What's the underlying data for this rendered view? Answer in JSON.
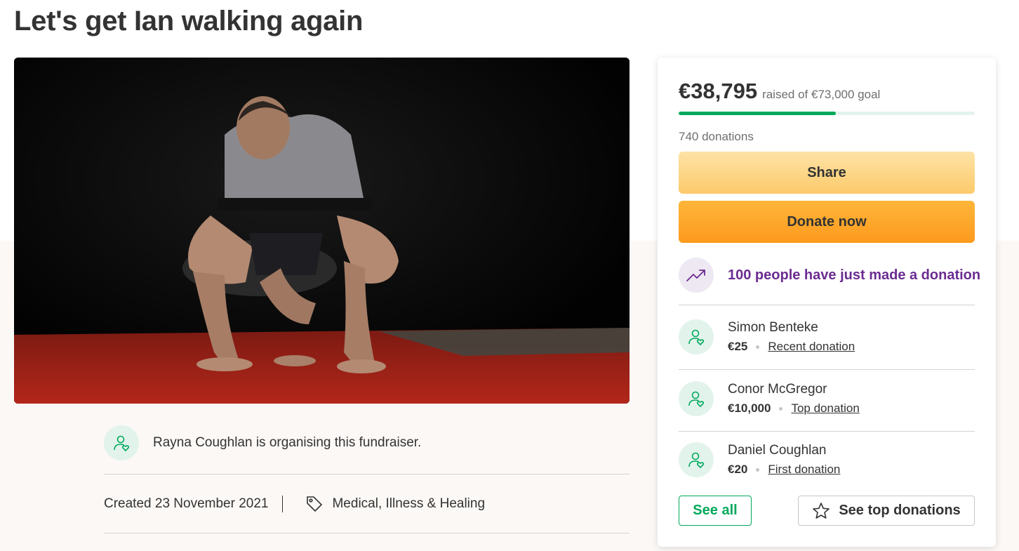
{
  "page": {
    "title": "Let's get Ian walking again"
  },
  "organiser": {
    "text": "Rayna Coughlan is organising this fundraiser.",
    "icon": "user-heart-icon"
  },
  "meta": {
    "created": "Created 23 November 2021",
    "category": "Medical, Illness & Healing",
    "category_icon": "tag-icon"
  },
  "donation_card": {
    "raised_amount": "€38,795",
    "goal_text": "raised of €73,000 goal",
    "progress_fraction": 0.531,
    "donation_count": "740 donations",
    "share_label": "Share",
    "donate_label": "Donate now",
    "trend_text": "100 people have just made a donation",
    "trend_icon": "trending-up-icon",
    "donors": [
      {
        "name": "Simon Benteke",
        "amount": "€25",
        "type": "Recent donation"
      },
      {
        "name": "Conor McGregor",
        "amount": "€10,000",
        "type": "Top donation"
      },
      {
        "name": "Daniel Coughlan",
        "amount": "€20",
        "type": "First donation"
      }
    ],
    "see_all_label": "See all",
    "see_top_label": "See top donations",
    "see_top_icon": "star-icon"
  },
  "colors": {
    "accent_green": "#02a95c",
    "trend_purple": "#6b2c91",
    "donate_orange": "#fd9a1d"
  }
}
